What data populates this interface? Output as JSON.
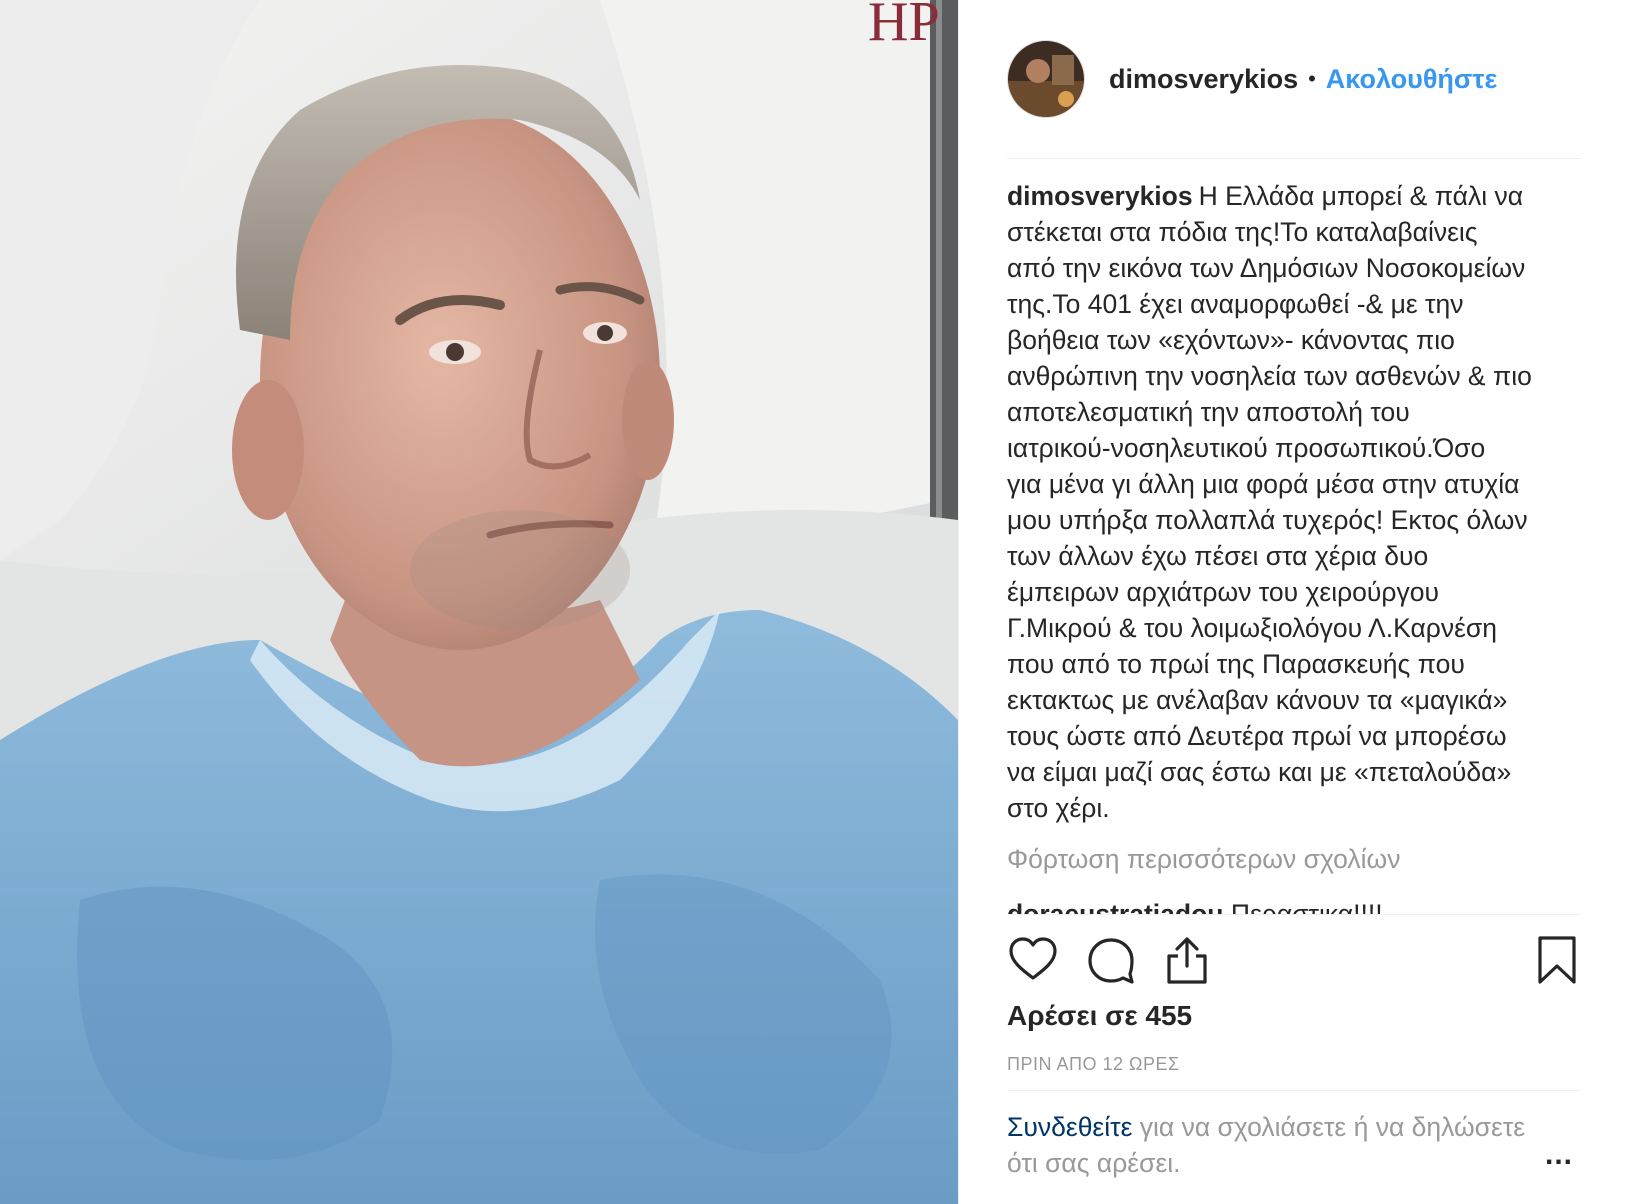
{
  "post": {
    "username": "dimosverykios",
    "follow_label": "Ακολουθήστε",
    "caption_lines": [
      "Η Ελλάδα μπορεί & πάλι να",
      "στέκεται στα πόδια της!Το καταλαβαίνεις",
      "από την εικόνα των Δημόσιων Νοσοκομείων",
      "της.Το 401 έχει αναμορφωθεί -& με την",
      "βοήθεια των «εχόντων»- κάνοντας πιο",
      "ανθρώπινη την νοσηλεία των ασθενών & πιο",
      "αποτελεσματική την αποστολή του",
      "ιατρικού-νοσηλευτικού προσωπικού.Όσο",
      "για μένα γι άλλη μια φορά μέσα στην ατυχία",
      "μου υπήρξα πολλαπλά τυχερός! Εκτος όλων",
      "των άλλων έχω πέσει στα χέρια δυο",
      "έμπειρων αρχιάτρων του χειρούργου",
      "Γ.Μικρού & του λοιμωξιολόγου Λ.Καρνέση",
      "που από το πρωί της Παρασκευής που",
      "εκτακτως με ανέλαβαν κάνουν τα «μαγικά»",
      "τους ώστε από Δευτέρα πρωί να μπορέσω",
      "να είμαι μαζί σας έστω και με «πεταλούδα»",
      "στο χέρι."
    ],
    "load_more": "Φόρτωση περισσότερων σχολίων",
    "first_comment_user": "doraeustratiadou",
    "first_comment_text": "Περαστικα!!!!",
    "likes_label": "Αρέσει σε 455",
    "time_label": "ΠΡΙΝ ΑΠΟ 12 ΩΡΕΣ",
    "login_link": "Συνδεθείτε",
    "login_rest": "για να σχολιάσετε ή να δηλώσετε ότι σας αρέσει.",
    "more_label": "..."
  },
  "photo": {
    "pillow_monogram": "HP"
  },
  "icons": [
    "heart-icon",
    "comment-icon",
    "share-icon",
    "bookmark-icon"
  ],
  "colors": {
    "follow": "#3897f0",
    "login_link": "#003569",
    "muted": "#999999",
    "text": "#262626"
  }
}
